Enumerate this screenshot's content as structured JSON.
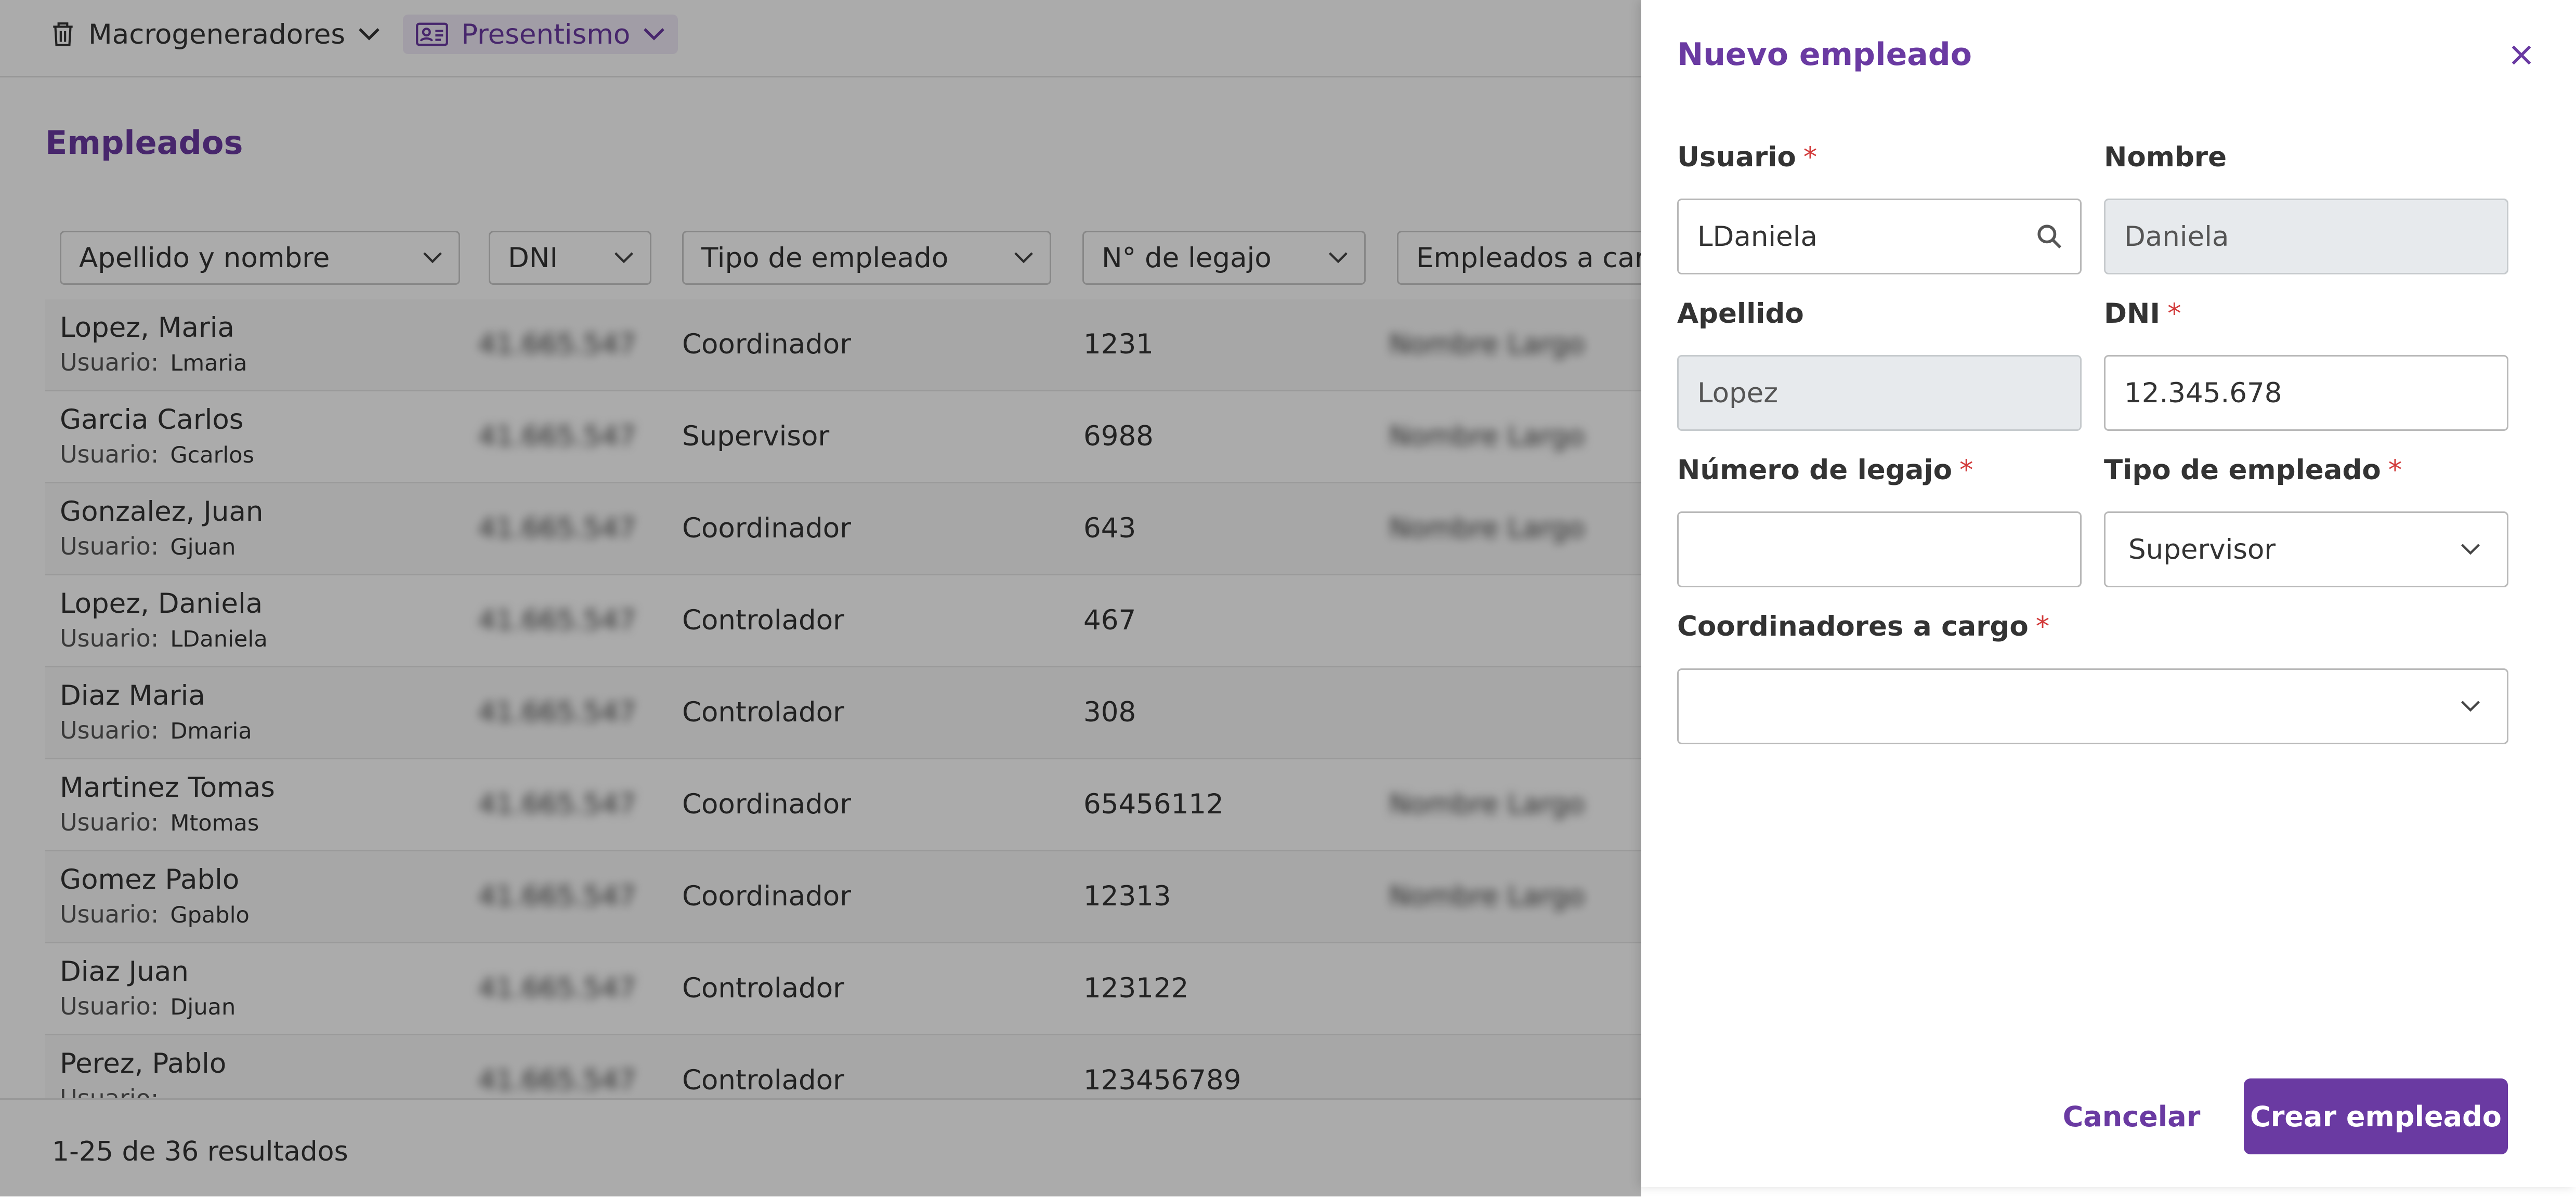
{
  "nav": {
    "items": [
      {
        "label": "Macrogeneradores"
      },
      {
        "label": "Presentismo"
      }
    ]
  },
  "page": {
    "title": "Empleados"
  },
  "filters": [
    {
      "label": "Apellido y nombre"
    },
    {
      "label": "DNI"
    },
    {
      "label": "Tipo de empleado"
    },
    {
      "label": "N° de legajo"
    },
    {
      "label": "Empleados a cargo"
    }
  ],
  "table": {
    "user_prefix": "Usuario:",
    "rows": [
      {
        "name": "Lopez, Maria",
        "user": "Lmaria",
        "dni": "41.665.547",
        "tipo": "Coordinador",
        "legajo": "1231",
        "empleados": "Nombre Largo"
      },
      {
        "name": "Garcia Carlos",
        "user": "Gcarlos",
        "dni": "41.665.547",
        "tipo": "Supervisor",
        "legajo": "6988",
        "empleados": "Nombre Largo"
      },
      {
        "name": "Gonzalez, Juan",
        "user": "Gjuan",
        "dni": "41.665.547",
        "tipo": "Coordinador",
        "legajo": "643",
        "empleados": "Nombre Largo"
      },
      {
        "name": "Lopez, Daniela",
        "user": "LDaniela",
        "dni": "41.665.547",
        "tipo": "Controlador",
        "legajo": "467",
        "empleados": ""
      },
      {
        "name": "Diaz Maria",
        "user": "Dmaria",
        "dni": "41.665.547",
        "tipo": "Controlador",
        "legajo": "308",
        "empleados": ""
      },
      {
        "name": "Martinez Tomas",
        "user": "Mtomas",
        "dni": "41.665.547",
        "tipo": "Coordinador",
        "legajo": "65456112",
        "empleados": "Nombre Largo"
      },
      {
        "name": "Gomez Pablo",
        "user": "Gpablo",
        "dni": "41.665.547",
        "tipo": "Coordinador",
        "legajo": "12313",
        "empleados": "Nombre Largo"
      },
      {
        "name": "Diaz Juan",
        "user": "Djuan",
        "dni": "41.665.547",
        "tipo": "Controlador",
        "legajo": "123122",
        "empleados": ""
      },
      {
        "name": "Perez, Pablo",
        "user": "",
        "dni": "41.665.547",
        "tipo": "Controlador",
        "legajo": "123456789",
        "empleados": ""
      }
    ]
  },
  "pagination": {
    "results": "1-25 de 36 resultados"
  },
  "panel": {
    "title": "Nuevo empleado",
    "required_mark": "*",
    "fields": {
      "usuario": {
        "label": "Usuario",
        "value": "LDaniela",
        "required": true
      },
      "nombre": {
        "label": "Nombre",
        "value": "Daniela",
        "required": false
      },
      "apellido": {
        "label": "Apellido",
        "value": "Lopez",
        "required": false
      },
      "dni": {
        "label": "DNI",
        "value": "12.345.678",
        "required": true
      },
      "legajo": {
        "label": "Número de legajo",
        "value": "",
        "required": true
      },
      "tipo": {
        "label": "Tipo de empleado",
        "value": "Supervisor",
        "required": true
      },
      "coordinadores": {
        "label": "Coordinadores a cargo",
        "value": "",
        "required": true
      }
    },
    "cancel_label": "Cancelar",
    "create_label": "Crear empleado"
  },
  "colors": {
    "accent": "#6a3aa2",
    "required": "#d23a3a",
    "overlay": "rgba(0,0,0,0.33)"
  },
  "icons": {
    "nav_macro": "trash-icon",
    "nav_presentismo": "id-card-icon",
    "search": "search-icon",
    "close": "close-icon",
    "dropdown": "chevron-down-icon"
  }
}
